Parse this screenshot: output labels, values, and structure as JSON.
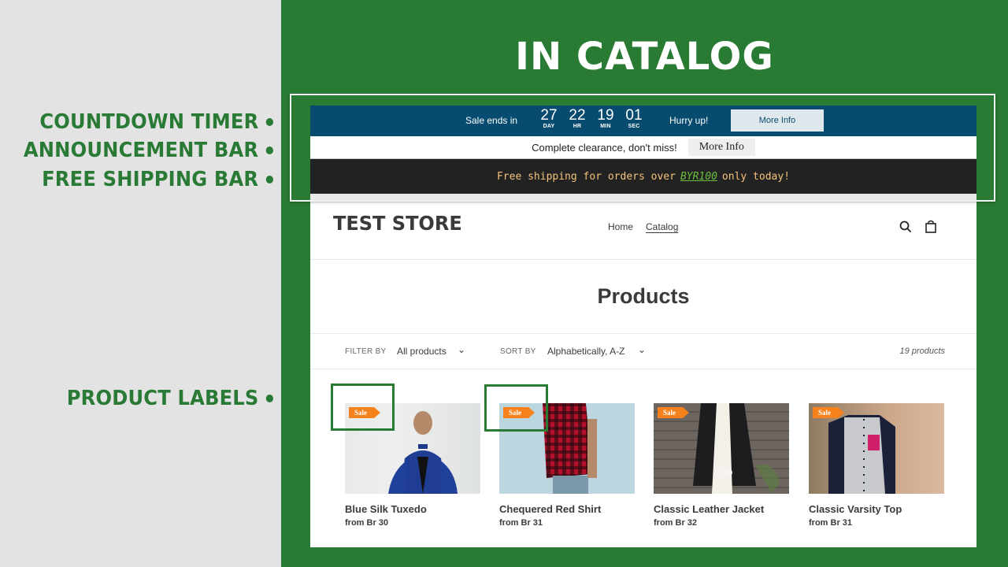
{
  "callouts": [
    {
      "label": "COUNTDOWN TIMER"
    },
    {
      "label": "ANNOUNCEMENT BAR"
    },
    {
      "label": "FREE SHIPPING BAR"
    },
    {
      "label": "PRODUCT LABELS"
    }
  ],
  "headline": "IN CATALOG",
  "colors": {
    "brand_green": "#297a33",
    "timer_bg": "#074b6f",
    "sale_label": "#f7811c",
    "shipping_bg": "#222222"
  },
  "timer": {
    "label": "Sale ends in",
    "units": [
      {
        "value": "27",
        "label": "DAY"
      },
      {
        "value": "22",
        "label": "HR"
      },
      {
        "value": "19",
        "label": "MIN"
      },
      {
        "value": "01",
        "label": "SEC"
      }
    ],
    "hurry": "Hurry up!",
    "button": "More Info"
  },
  "announcement": {
    "text": "Complete clearance, don't miss!",
    "button": "More Info"
  },
  "shipping": {
    "prefix": "Free shipping for orders over",
    "amount": "BYR100",
    "suffix": "only today!"
  },
  "store": {
    "logo": "TEST STORE",
    "nav": [
      {
        "label": "Home"
      },
      {
        "label": "Catalog"
      }
    ],
    "page_title": "Products",
    "filter": {
      "label": "FILTER BY",
      "value": "All products"
    },
    "sort": {
      "label": "SORT BY",
      "value": "Alphabetically, A-Z"
    },
    "count": "19 products",
    "products": [
      {
        "title": "Blue Silk Tuxedo",
        "price": "from Br 30",
        "badge": "Sale"
      },
      {
        "title": "Chequered Red Shirt",
        "price": "from Br 31",
        "badge": "Sale"
      },
      {
        "title": "Classic Leather Jacket",
        "price": "from Br 32",
        "badge": "Sale"
      },
      {
        "title": "Classic Varsity Top",
        "price": "from Br 31",
        "badge": "Sale"
      }
    ]
  }
}
